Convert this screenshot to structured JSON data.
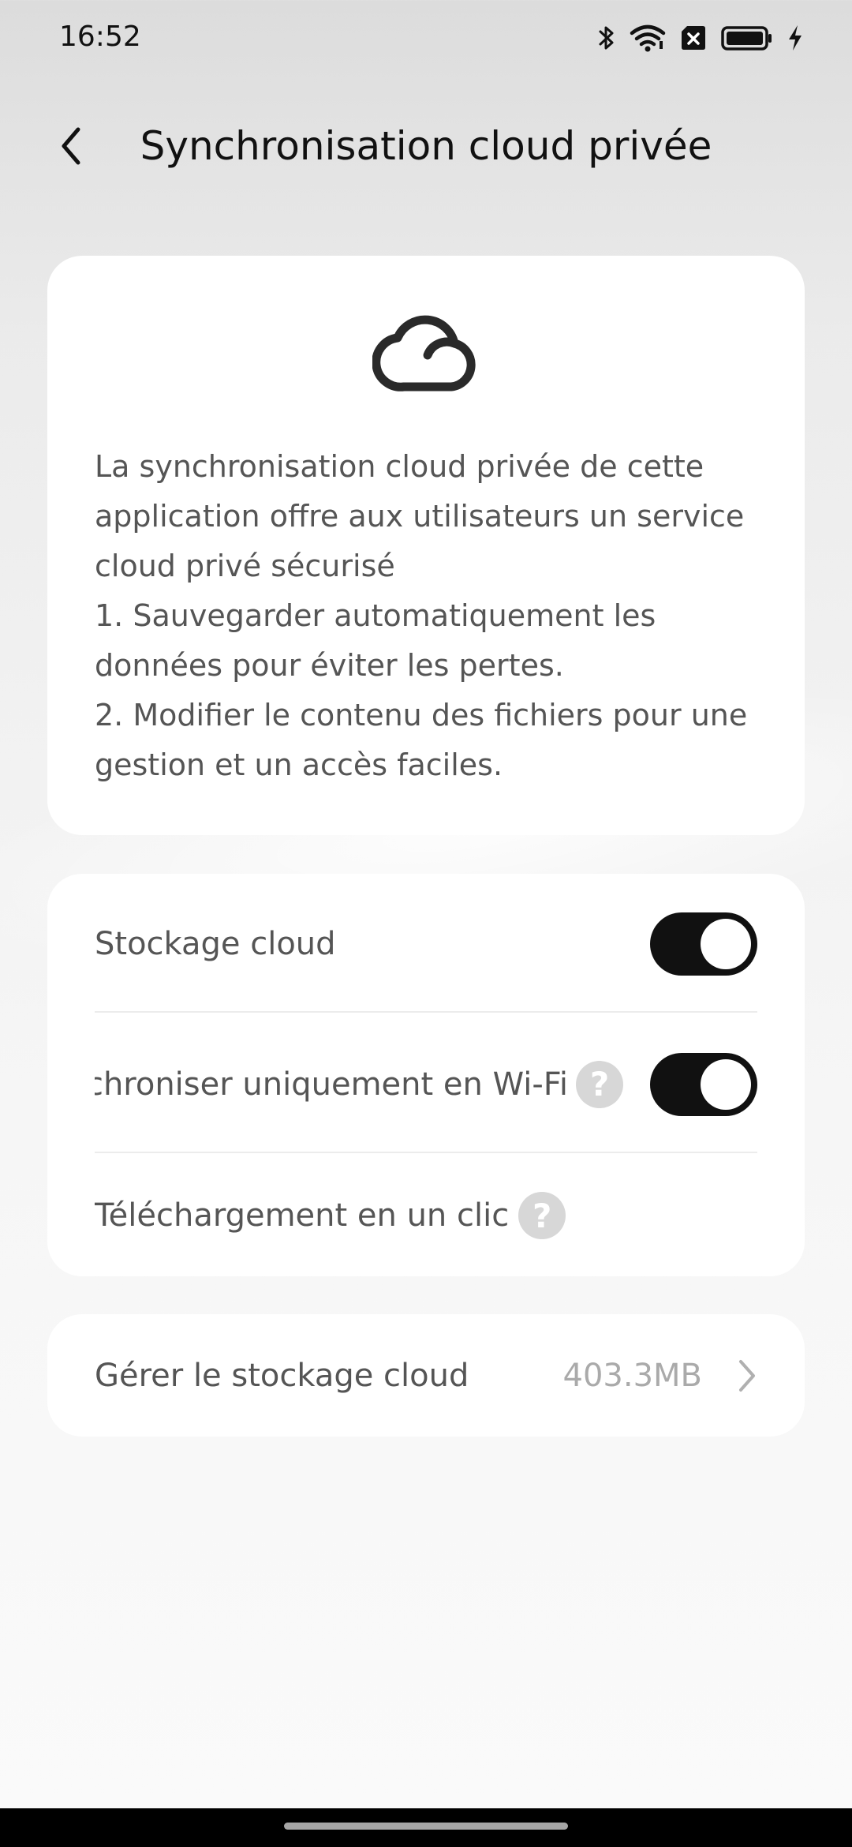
{
  "status_bar": {
    "time": "16:52",
    "icons": [
      "bluetooth-icon",
      "wifi-icon",
      "no-sim-icon",
      "battery-icon",
      "charging-icon"
    ]
  },
  "header": {
    "title": "Synchronisation cloud privée",
    "back_icon": "chevron-left-icon"
  },
  "intro": {
    "icon": "cloud-icon",
    "text": "La synchronisation cloud privée de cette application offre aux utilisateurs un service cloud privé sécurisé\n1. Sauvegarder automatiquement les données pour éviter les pertes.\n2. Modifier le contenu des fichiers pour une gestion et un accès faciles."
  },
  "settings": {
    "cloud_storage": {
      "label": "Stockage cloud",
      "enabled": true
    },
    "wifi_only": {
      "label": "Synchroniser uniquement en Wi-Fi",
      "enabled": true,
      "help_icon": "question-icon"
    },
    "one_click_download": {
      "label": "Téléchargement en un clic",
      "help_icon": "question-icon"
    }
  },
  "manage": {
    "label": "Gérer le stockage cloud",
    "value": "403.3MB",
    "icon": "chevron-right-icon"
  },
  "colors": {
    "toggle_on": "#111111",
    "card_bg": "#ffffff",
    "help_bg": "#d7d7d7",
    "secondary_text": "#aaaaaa"
  }
}
